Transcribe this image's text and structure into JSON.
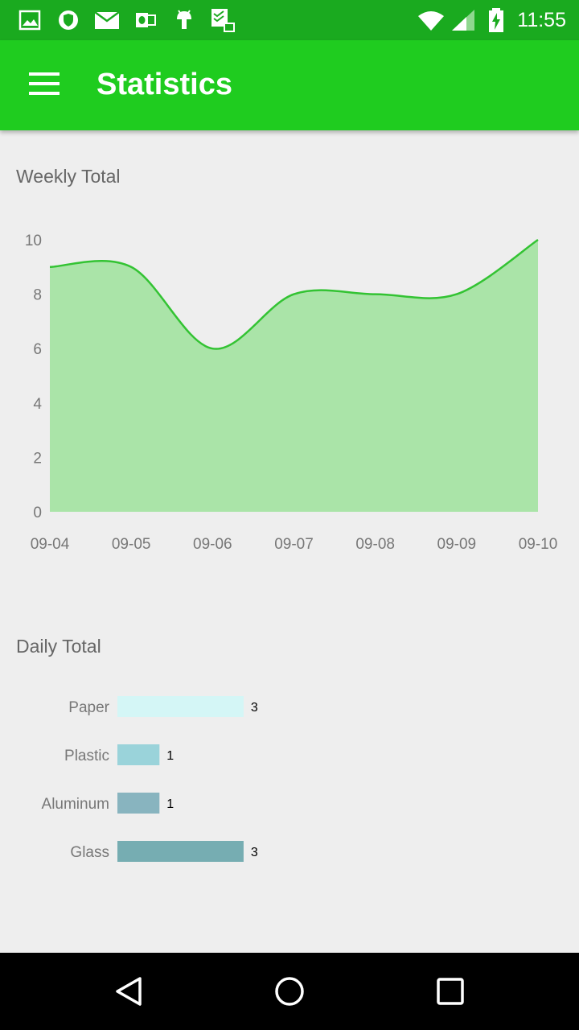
{
  "status_bar": {
    "time": "11:55",
    "icons": [
      "gallery-icon",
      "shield-icon",
      "mail-icon",
      "outlook-icon",
      "android-icon",
      "clipboard-icon",
      "wifi-icon",
      "signal-icon",
      "battery-charging-icon"
    ]
  },
  "app_bar": {
    "title": "Statistics",
    "menu_icon": "hamburger-menu-icon",
    "color": "#1fcc1f"
  },
  "weekly": {
    "title": "Weekly Total"
  },
  "daily": {
    "title": "Daily Total"
  },
  "chart_data": [
    {
      "type": "area",
      "title": "Weekly Total",
      "x": [
        "09-04",
        "09-05",
        "09-06",
        "09-07",
        "09-08",
        "09-09",
        "09-10"
      ],
      "values": [
        9,
        9,
        6,
        8,
        8,
        8,
        10
      ],
      "ylim": [
        0,
        10
      ],
      "yticks": [
        0,
        2,
        4,
        6,
        8,
        10
      ],
      "line_color": "#33c333",
      "fill_color": "#aae4a8",
      "grid": false
    },
    {
      "type": "bar",
      "orientation": "horizontal",
      "title": "Daily Total",
      "categories": [
        "Paper",
        "Plastic",
        "Aluminum",
        "Glass"
      ],
      "values": [
        3,
        1,
        1,
        3
      ],
      "colors": [
        "#d4f6f6",
        "#9ad3da",
        "#88b4bf",
        "#76adb2"
      ],
      "grid": false
    }
  ],
  "nav_bar": {
    "icons": [
      "back-icon",
      "home-icon",
      "recents-icon"
    ]
  }
}
